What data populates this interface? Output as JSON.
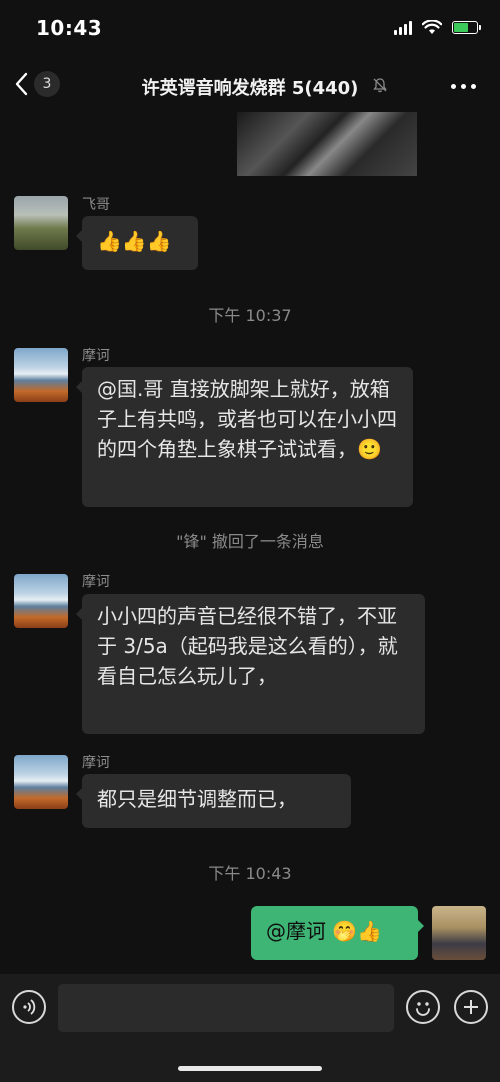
{
  "status_bar": {
    "time": "10:43"
  },
  "nav": {
    "unread_count": "3",
    "title": "许英谔音响发烧群 5(440)"
  },
  "messages": {
    "feige": {
      "sender": "飞哥",
      "text": "👍👍👍"
    },
    "timestamp1": "下午 10:37",
    "mohe1": {
      "sender": "摩诃",
      "text": "@国.哥 直接放脚架上就好，放箱子上有共鸣，或者也可以在小小四的四个角垫上象棋子试试看，🙂"
    },
    "recall_notice": "\"锋\" 撤回了一条消息",
    "mohe2": {
      "sender": "摩诃",
      "text": "小小四的声音已经很不错了，不亚于 3/5a（起码我是这么看的），就看自己怎么玩儿了，"
    },
    "mohe3": {
      "sender": "摩诃",
      "text": "都只是细节调整而已，"
    },
    "timestamp2": "下午 10:43",
    "mine": {
      "text": "@摩诃 🤭👍"
    }
  },
  "colors": {
    "background": "#111111",
    "bubble_incoming": "#2c2c2c",
    "bubble_outgoing": "#3eb575",
    "meta_text": "#8a8a8a"
  },
  "icons": [
    "back-chevron-icon",
    "mute-bell-icon",
    "more-dots-icon",
    "voice-icon",
    "emoji-icon",
    "plus-icon",
    "signal-icon",
    "wifi-icon",
    "battery-icon"
  ]
}
